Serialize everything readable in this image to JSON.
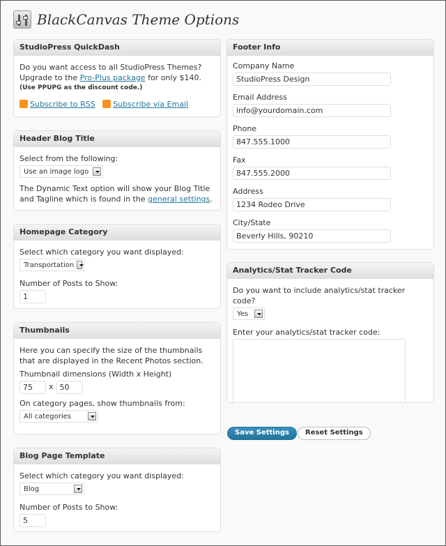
{
  "title": "BlackCanvas Theme Options",
  "quickdash": {
    "heading": "StudioPress QuickDash",
    "line1": "Do you want access to all StudioPress Themes?",
    "line2_pre": "Upgrade to the ",
    "line2_link": "Pro-Plus package",
    "line2_post": " for only $140.",
    "note": "(Use PPUPG as the discount code.)",
    "rss": "Subscribe to RSS",
    "email": "Subscribe via Email"
  },
  "header_blog": {
    "heading": "Header Blog Title",
    "label": "Select from the following:",
    "select": "Use an image logo",
    "desc_pre": "The Dynamic Text option will show your Blog Title and Tagline which is found in the ",
    "desc_link": "general settings",
    "desc_post": "."
  },
  "homepage": {
    "heading": "Homepage Category",
    "label": "Select which category you want displayed:",
    "select": "Transportation",
    "posts_label": "Number of Posts to Show:",
    "posts": "1"
  },
  "thumbs": {
    "heading": "Thumbnails",
    "desc": "Here you can specify the size of the thumbnails that are displayed in the Recent Photos section.",
    "dim_label": "Thumbnail dimensions (Width x Height)",
    "width": "75",
    "x": "x",
    "height": "50",
    "cat_label": "On category pages, show thumbnails from:",
    "cat_select": "All categories"
  },
  "blog": {
    "heading": "Blog Page Template",
    "label": "Select which category you want displayed:",
    "select": "Blog",
    "posts_label": "Number of Posts to Show:",
    "posts": "5"
  },
  "footer": {
    "heading": "Footer Info",
    "fields": [
      {
        "label": "Company Name",
        "value": "StudioPress Design"
      },
      {
        "label": "Email Address",
        "value": "info@yourdomain.com"
      },
      {
        "label": "Phone",
        "value": "847.555.1000"
      },
      {
        "label": "Fax",
        "value": "847.555.2000"
      },
      {
        "label": "Address",
        "value": "1234 Rodeo Drive"
      },
      {
        "label": "City/State",
        "value": "Beverly Hills, 90210"
      }
    ]
  },
  "analytics": {
    "heading": "Analytics/Stat Tracker Code",
    "label": "Do you want to include analytics/stat tracker code?",
    "select": "Yes",
    "code_label": "Enter your analytics/stat tracker code:",
    "code": ""
  },
  "buttons": {
    "save": "Save Settings",
    "reset": "Reset Settings"
  },
  "colors": {
    "link": "#21759b",
    "save_button": "#21759b"
  }
}
